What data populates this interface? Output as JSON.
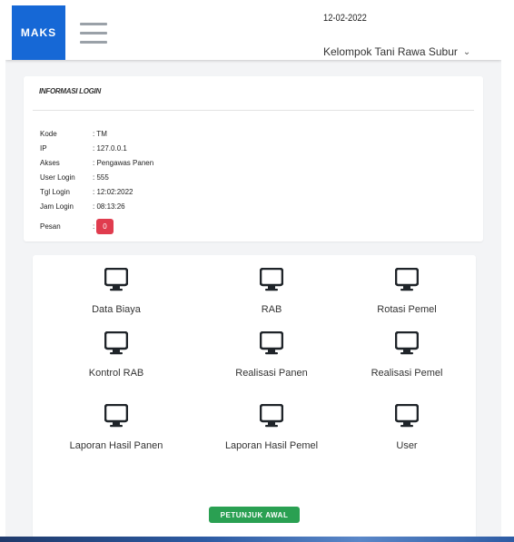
{
  "header": {
    "brand": "MAKS",
    "date": "12-02-2022",
    "group": "Kelompok Tani Rawa Subur"
  },
  "login_info": {
    "title": "INFORMASI LOGIN",
    "rows": [
      {
        "label": "Kode",
        "value": ": TM"
      },
      {
        "label": "IP",
        "value": ": 127.0.0.1"
      },
      {
        "label": "Akses",
        "value": ": Pengawas Panen"
      },
      {
        "label": "User Login",
        "value": ": 555"
      },
      {
        "label": "Tgl Login",
        "value": ": 12:02:2022"
      },
      {
        "label": "Jam Login",
        "value": ": 08:13:26"
      }
    ],
    "pesan_label": "Pesan",
    "pesan_colon": ":",
    "pesan_count": "0",
    "pesan_color": "#e03c4e"
  },
  "menu": {
    "icon": "monitor-icon",
    "tiles": [
      {
        "label": "Data Biaya"
      },
      {
        "label": "RAB"
      },
      {
        "label": "Rotasi Pemel"
      },
      {
        "label": "Kontrol RAB"
      },
      {
        "label": "Realisasi Panen"
      },
      {
        "label": "Realisasi Pemel"
      },
      {
        "label": "Laporan Hasil Panen"
      },
      {
        "label": "Laporan Hasil Pemel"
      },
      {
        "label": "User"
      }
    ],
    "start_button": "PETUNJUK AWAL"
  },
  "colors": {
    "brand": "#1668d6",
    "badge": "#e03c4e",
    "start_button": "#2aa052"
  }
}
